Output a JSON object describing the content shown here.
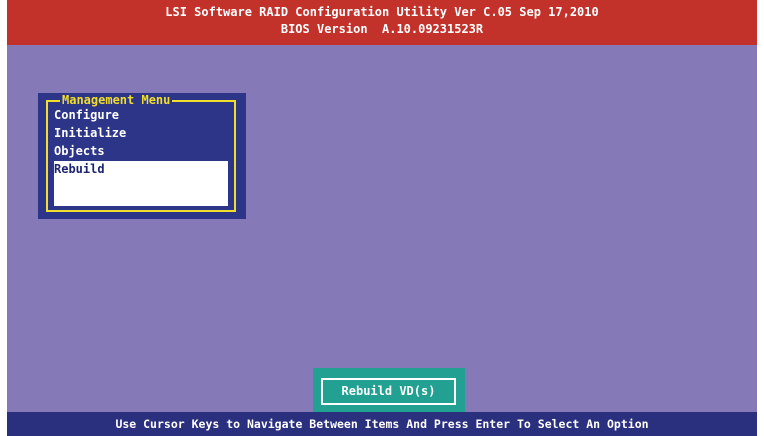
{
  "header": {
    "title_line1": "LSI Software RAID Configuration Utility Ver C.05 Sep 17,2010",
    "title_line2": "BIOS Version  A.10.09231523R"
  },
  "menu": {
    "title": "Management Menu",
    "items": [
      {
        "label": "Configure"
      },
      {
        "label": "Initialize"
      },
      {
        "label": "Objects"
      },
      {
        "label": "Rebuild"
      }
    ],
    "selected_index": 3
  },
  "action": {
    "label": "Rebuild VD(s)"
  },
  "status": {
    "text": "Use Cursor Keys to Navigate Between Items And Press Enter To Select An Option"
  },
  "colors": {
    "background": "#8579b8",
    "title_bar": "#c2322b",
    "menu_box": "#2c3587",
    "menu_border": "#f1dd2c",
    "action_box": "#22a092",
    "status_bar": "#2a2f7e"
  }
}
